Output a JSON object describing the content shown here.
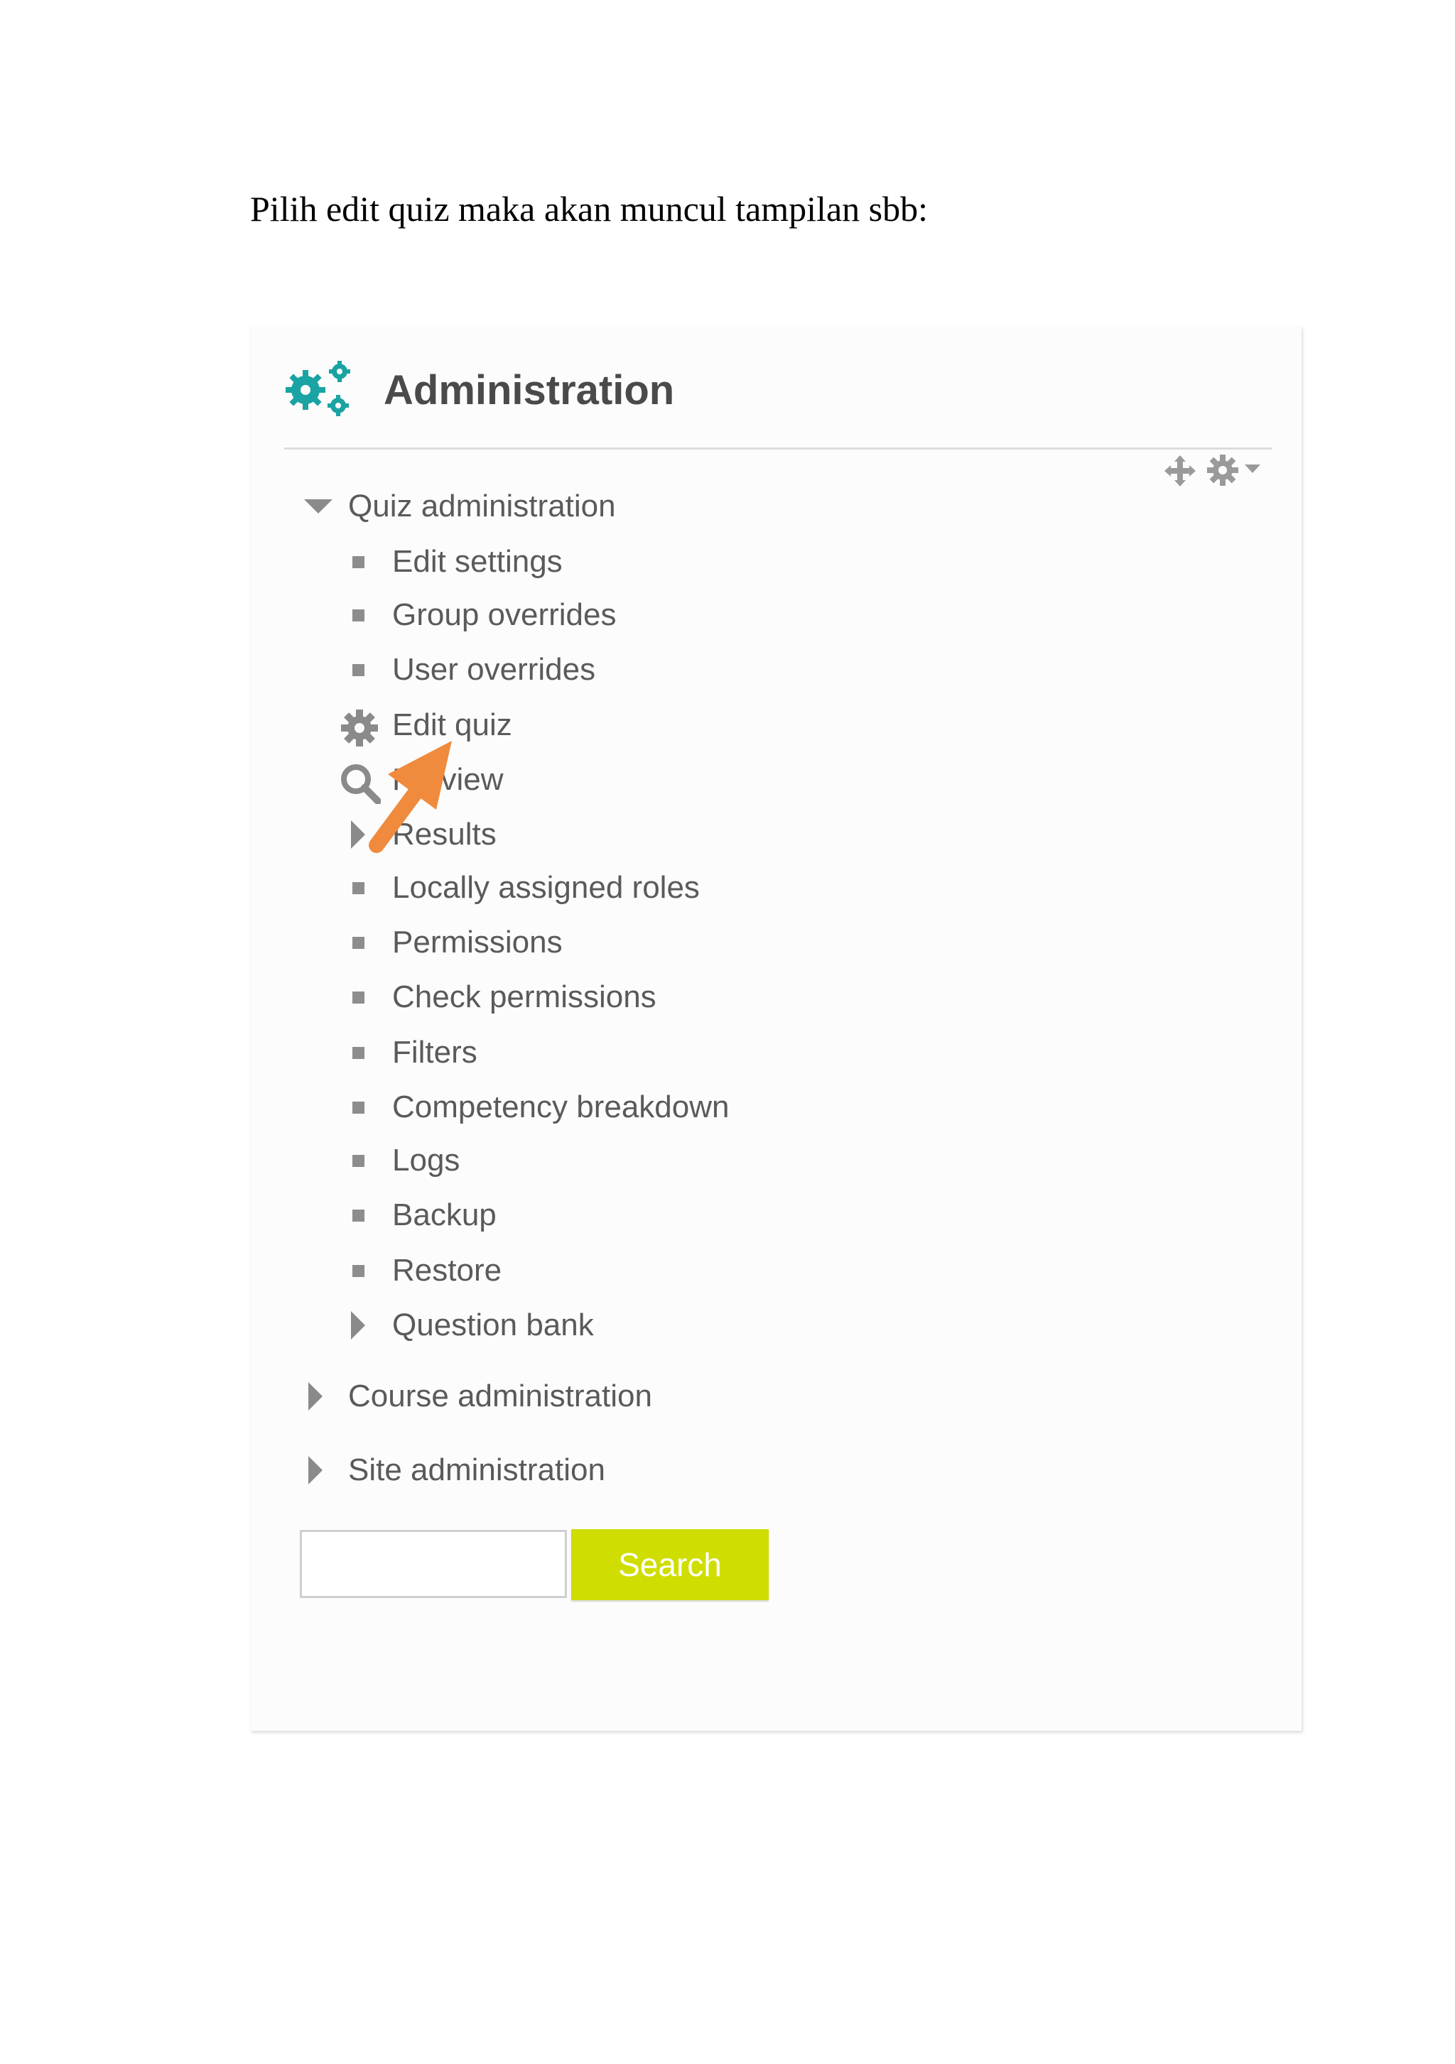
{
  "document": {
    "intro_text": "Pilih edit quiz maka akan muncul tampilan sbb:"
  },
  "block": {
    "title": "Administration",
    "header_icon": "gears-icon",
    "controls": [
      "move-icon",
      "gear-icon",
      "caret-down-icon"
    ]
  },
  "tree": {
    "quiz_admin": {
      "label": "Quiz administration",
      "state": "expanded"
    },
    "items": [
      {
        "label": "Edit settings",
        "icon": "bullet"
      },
      {
        "label": "Group overrides",
        "icon": "bullet"
      },
      {
        "label": "User overrides",
        "icon": "bullet"
      },
      {
        "label": "Edit quiz",
        "icon": "gear-icon"
      },
      {
        "label": "Preview",
        "icon": "magnifier-icon"
      },
      {
        "label": "Results",
        "icon": "expand-triangle"
      },
      {
        "label": "Locally assigned roles",
        "icon": "bullet"
      },
      {
        "label": "Permissions",
        "icon": "bullet"
      },
      {
        "label": "Check permissions",
        "icon": "bullet"
      },
      {
        "label": "Filters",
        "icon": "bullet"
      },
      {
        "label": "Competency breakdown",
        "icon": "bullet"
      },
      {
        "label": "Logs",
        "icon": "bullet"
      },
      {
        "label": "Backup",
        "icon": "bullet"
      },
      {
        "label": "Restore",
        "icon": "bullet"
      },
      {
        "label": "Question bank",
        "icon": "expand-triangle"
      }
    ],
    "course_admin": {
      "label": "Course administration",
      "state": "collapsed"
    },
    "site_admin": {
      "label": "Site administration",
      "state": "collapsed"
    }
  },
  "search": {
    "input_value": "",
    "button_label": "Search"
  },
  "annotation": {
    "icon": "pointer-arrow",
    "color": "#f08a3c"
  },
  "colors": {
    "accent": "#1aa3a3",
    "button": "#cfdd00",
    "text": "#5a5a5a"
  }
}
